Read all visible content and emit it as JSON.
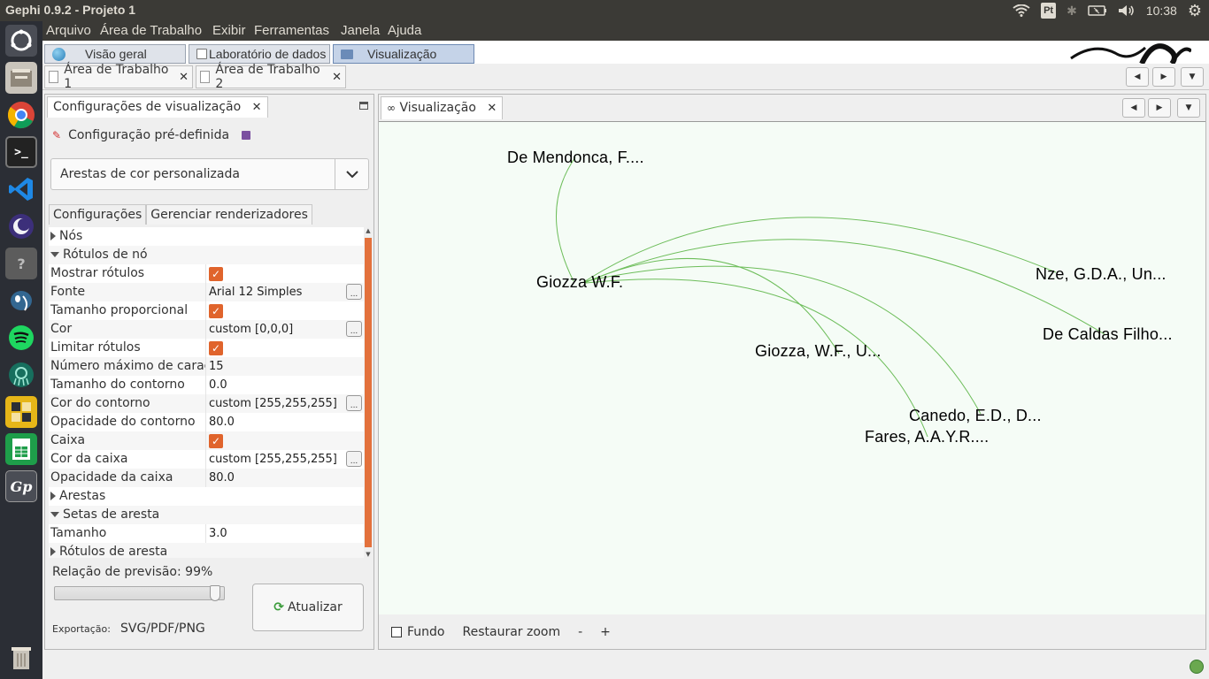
{
  "app": {
    "title": "Gephi 0.9.2 - Projeto 1"
  },
  "tray": {
    "language": "Pt",
    "clock": "10:38"
  },
  "menu": [
    "Arquivo",
    "Área de Trabalho",
    "Exibir",
    "Ferramentas",
    "Janela",
    "Ajuda"
  ],
  "perspectives": [
    "Visão geral",
    "Laboratório de dados",
    "Visualização"
  ],
  "workspaces": [
    "Área de Trabalho 1",
    "Área de Trabalho 2"
  ],
  "settings_panel": {
    "title": "Configurações de visualização",
    "preset_label": "Configuração pré-definida",
    "preset_value": "Arestas de cor personalizada",
    "tabs": [
      "Configurações",
      "Gerenciar renderizadores"
    ],
    "rows": [
      {
        "type": "cat",
        "open": false,
        "name": "Nós"
      },
      {
        "type": "cat",
        "open": true,
        "name": "Rótulos de nó"
      },
      {
        "type": "check",
        "name": "Mostrar rótulos",
        "checked": true
      },
      {
        "type": "text",
        "name": "Fonte",
        "value": "Arial 12 Simples",
        "ellipsis": true
      },
      {
        "type": "check",
        "name": "Tamanho proporcional",
        "checked": true
      },
      {
        "type": "text",
        "name": "Cor",
        "value": "custom [0,0,0]",
        "ellipsis": true
      },
      {
        "type": "check",
        "name": "Limitar rótulos",
        "checked": true
      },
      {
        "type": "text",
        "name": "Número máximo de carac",
        "value": "15"
      },
      {
        "type": "text",
        "name": "Tamanho do contorno",
        "value": "0.0"
      },
      {
        "type": "text",
        "name": "Cor do contorno",
        "value": "custom [255,255,255]",
        "ellipsis": true
      },
      {
        "type": "text",
        "name": "Opacidade do contorno",
        "value": "80.0"
      },
      {
        "type": "check",
        "name": "Caixa",
        "checked": true
      },
      {
        "type": "text",
        "name": "Cor da caixa",
        "value": "custom [255,255,255]",
        "ellipsis": true
      },
      {
        "type": "text",
        "name": "Opacidade da caixa",
        "value": "80.0"
      },
      {
        "type": "cat",
        "open": false,
        "name": "Arestas"
      },
      {
        "type": "cat",
        "open": true,
        "name": "Setas de aresta"
      },
      {
        "type": "text",
        "name": "Tamanho",
        "value": "3.0"
      },
      {
        "type": "cat",
        "open": false,
        "name": "Rótulos de aresta"
      }
    ],
    "preview_ratio_label": "Relação de previsão:",
    "preview_ratio_value": "99%",
    "preview_ratio": 0.99,
    "update_button": "Atualizar",
    "export_label": "Exportação:",
    "export_formats": "SVG/PDF/PNG"
  },
  "visualization": {
    "tab_title": "Visualização",
    "background_label": "Fundo",
    "reset_zoom": "Restaurar zoom",
    "zoom_out": "-",
    "zoom_in": "+",
    "edge_color": "#6dbd5a",
    "nodes": [
      "De Mendonca, F....",
      "Giozza W.F.",
      "Nze, G.D.A., Un...",
      "De Caldas Filho...",
      "Giozza, W.F., U...",
      "Canedo, E.D., D...",
      "Fares, A.A.Y.R...."
    ]
  },
  "colors": {
    "accent": "#e0642c",
    "topbar": "#3b3a36",
    "launcher": "#2b2e35"
  }
}
